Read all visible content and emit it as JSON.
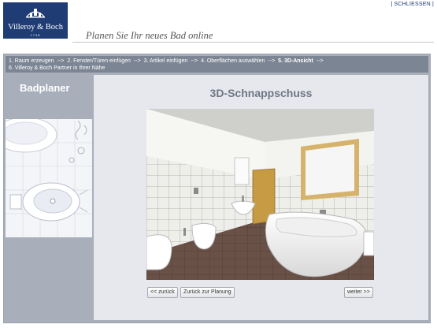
{
  "header": {
    "logo_name": "Villeroy & Boch",
    "logo_year": "1748",
    "close_label": "| SCHLIESSEN |",
    "title": "Planen Sie Ihr neues Bad online"
  },
  "steps": [
    {
      "label": "1. Raum erzeugen",
      "active": false
    },
    {
      "label": "2. Fenster/Türen einfügen",
      "active": false
    },
    {
      "label": "3. Artikel einfügen",
      "active": false
    },
    {
      "label": "4. Oberflächen auswählen",
      "active": false
    },
    {
      "label": "5. 3D-Ansicht",
      "active": true
    },
    {
      "label": "6. Villeroy & Boch Partner in Ihrer Nähe",
      "active": false
    }
  ],
  "step_separator": "-->",
  "sidebar": {
    "title": "Badplaner"
  },
  "main": {
    "title": "3D-Schnappschuss",
    "image_icon": "3d-bathroom-render"
  },
  "buttons": {
    "back": "<< zurück",
    "back_to_planning": "Zurück zur Planung",
    "next": "weiter >>"
  },
  "colors": {
    "brand": "#1f3c74",
    "frame": "#a8afbb",
    "steps_bar": "#7c8594",
    "content_bg": "#e6e8ee"
  }
}
